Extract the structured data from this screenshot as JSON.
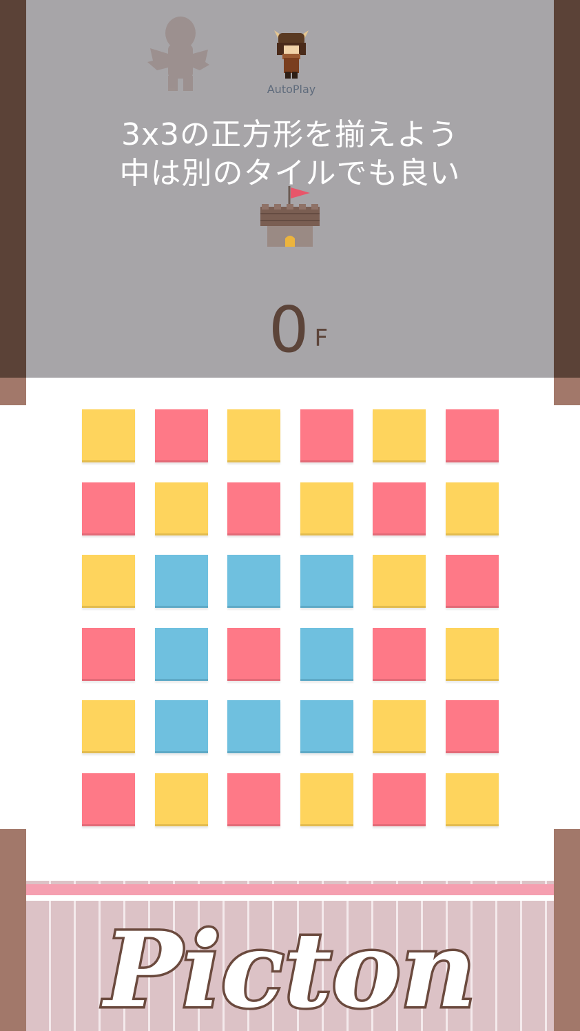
{
  "status": {
    "autoplay_label": "AutoPlay",
    "hint_line1": "3x3の正方形を揃えよう",
    "hint_line2": "中は別のタイルでも良い",
    "floor_number": "0",
    "floor_unit": "F"
  },
  "board": {
    "rows": 6,
    "cols": 6,
    "tiles": [
      [
        "yellow",
        "pink",
        "yellow",
        "pink",
        "yellow",
        "pink"
      ],
      [
        "pink",
        "yellow",
        "pink",
        "yellow",
        "pink",
        "yellow"
      ],
      [
        "yellow",
        "blue",
        "blue",
        "blue",
        "yellow",
        "pink"
      ],
      [
        "pink",
        "blue",
        "pink",
        "blue",
        "pink",
        "yellow"
      ],
      [
        "yellow",
        "blue",
        "blue",
        "blue",
        "yellow",
        "pink"
      ],
      [
        "pink",
        "yellow",
        "pink",
        "yellow",
        "pink",
        "yellow"
      ]
    ]
  },
  "colors": {
    "yellow": "#fed45d",
    "pink": "#fe7987",
    "blue": "#6fc0df",
    "overlay": "#a7a5a8",
    "pillar_dark": "#5b4237",
    "pillar_light": "#a2786a"
  },
  "logo": {
    "text": "Picton"
  }
}
